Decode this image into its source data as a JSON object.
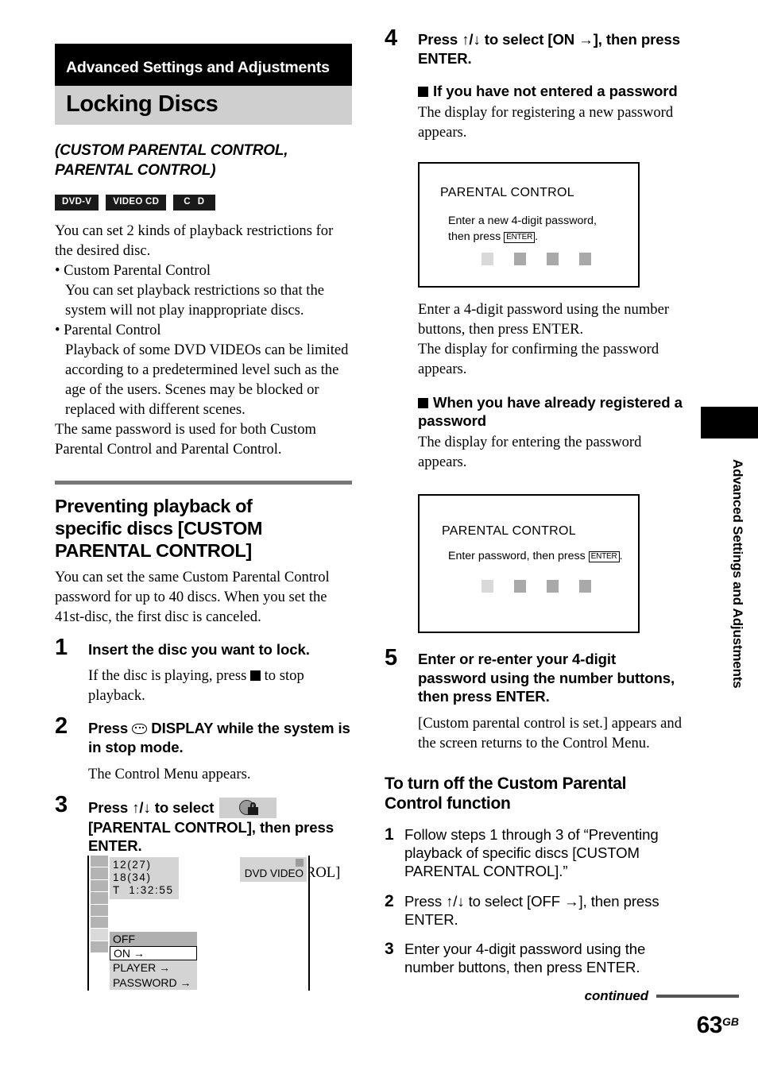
{
  "chapter_banner": "Advanced Settings and Adjustments",
  "page_title": "Locking Discs",
  "subtitle_line1": "(CUSTOM PARENTAL CONTROL,",
  "subtitle_line2": "PARENTAL CONTROL)",
  "badges": [
    {
      "label": "DVD-V",
      "name": "badge-dvd-v"
    },
    {
      "label": "VIDEO CD",
      "name": "badge-video-cd"
    },
    {
      "label": "C D",
      "name": "badge-cd"
    }
  ],
  "intro": {
    "para1": "You can set 2 kinds of playback restrictions for the desired disc.",
    "bullet1_title": "Custom Parental Control",
    "bullet1_body": "You can set playback restrictions so that the system will not play inappropriate discs.",
    "bullet2_title": "Parental Control",
    "bullet2_body": "Playback of some DVD VIDEOs can be limited according to a predetermined level such as the age of the users. Scenes may be blocked or replaced with different scenes.",
    "para2": "The same password is used for both Custom Parental Control and Parental Control."
  },
  "section": {
    "heading_line1": "Preventing playback of",
    "heading_line2": "specific discs [CUSTOM",
    "heading_line3": "PARENTAL CONTROL]",
    "intro": "You can set the same Custom Parental Control password for up to 40 discs. When you set the 41st-disc, the first disc is canceled."
  },
  "steps_left": [
    {
      "num": "1",
      "head": "Insert the disc you want to lock.",
      "sub_before": "If the disc is playing, press ",
      "sub_after": " to stop playback."
    },
    {
      "num": "2",
      "head_before": "Press ",
      "head_after": " DISPLAY while the system is in stop mode.",
      "sub": "The Control Menu appears."
    },
    {
      "num": "3",
      "head_before": "Press ↑/↓ to select ",
      "head_after": "[PARENTAL CONTROL], then press ENTER.",
      "sub": "The options for [PARENTAL CONTROL] appear."
    }
  ],
  "osd": {
    "info_line1": "12(27)",
    "info_line2": "18(34)",
    "info_line3": "T  1:32:55",
    "disc_label": "DVD VIDEO",
    "options": [
      {
        "label": "OFF",
        "state": "selected"
      },
      {
        "label": "ON →",
        "state": "current"
      },
      {
        "label": "PLAYER →",
        "state": "normal"
      },
      {
        "label": "PASSWORD →",
        "state": "normal"
      }
    ]
  },
  "step4": {
    "num": "4",
    "head": "Press ↑/↓ to select [ON →], then press ENTER.",
    "block1_title": "If you have not entered a password",
    "block1_body": "The display for registering a new password appears.",
    "after_dialog1_p1": "Enter a 4-digit password using the number buttons, then press ENTER.",
    "after_dialog1_p2": "The display for confirming the password appears.",
    "block2_title_line1": "When you have already registered a",
    "block2_title_line2": "password",
    "block2_body": "The display for entering the password appears."
  },
  "dialog1": {
    "title": "PARENTAL CONTROL",
    "line1": "Enter a new 4-digit password,",
    "line2_before": "then press ",
    "key": "ENTER",
    "line2_after": "."
  },
  "dialog2": {
    "title": "PARENTAL CONTROL",
    "line1_before": "Enter password, then press ",
    "key": "ENTER",
    "line1_after": "."
  },
  "step5": {
    "num": "5",
    "head": "Enter or re-enter your 4-digit password using the number buttons, then press ENTER.",
    "sub": "[Custom parental control is set.] appears and the screen returns to the Control Menu."
  },
  "turnoff": {
    "heading_line1": "To turn off the Custom Parental",
    "heading_line2": "Control function",
    "steps": [
      {
        "num": "1",
        "text": "Follow steps 1 through 3 of “Preventing playback of specific discs [CUSTOM PARENTAL CONTROL].”"
      },
      {
        "num": "2",
        "text": "Press ↑/↓ to select [OFF →], then press ENTER."
      },
      {
        "num": "3",
        "text": "Enter your 4-digit password using the number buttons, then press ENTER."
      }
    ]
  },
  "side_tab_text": "Advanced Settings and Adjustments",
  "footer": {
    "continued": "continued",
    "page_number": "63",
    "page_suffix": "GB"
  }
}
